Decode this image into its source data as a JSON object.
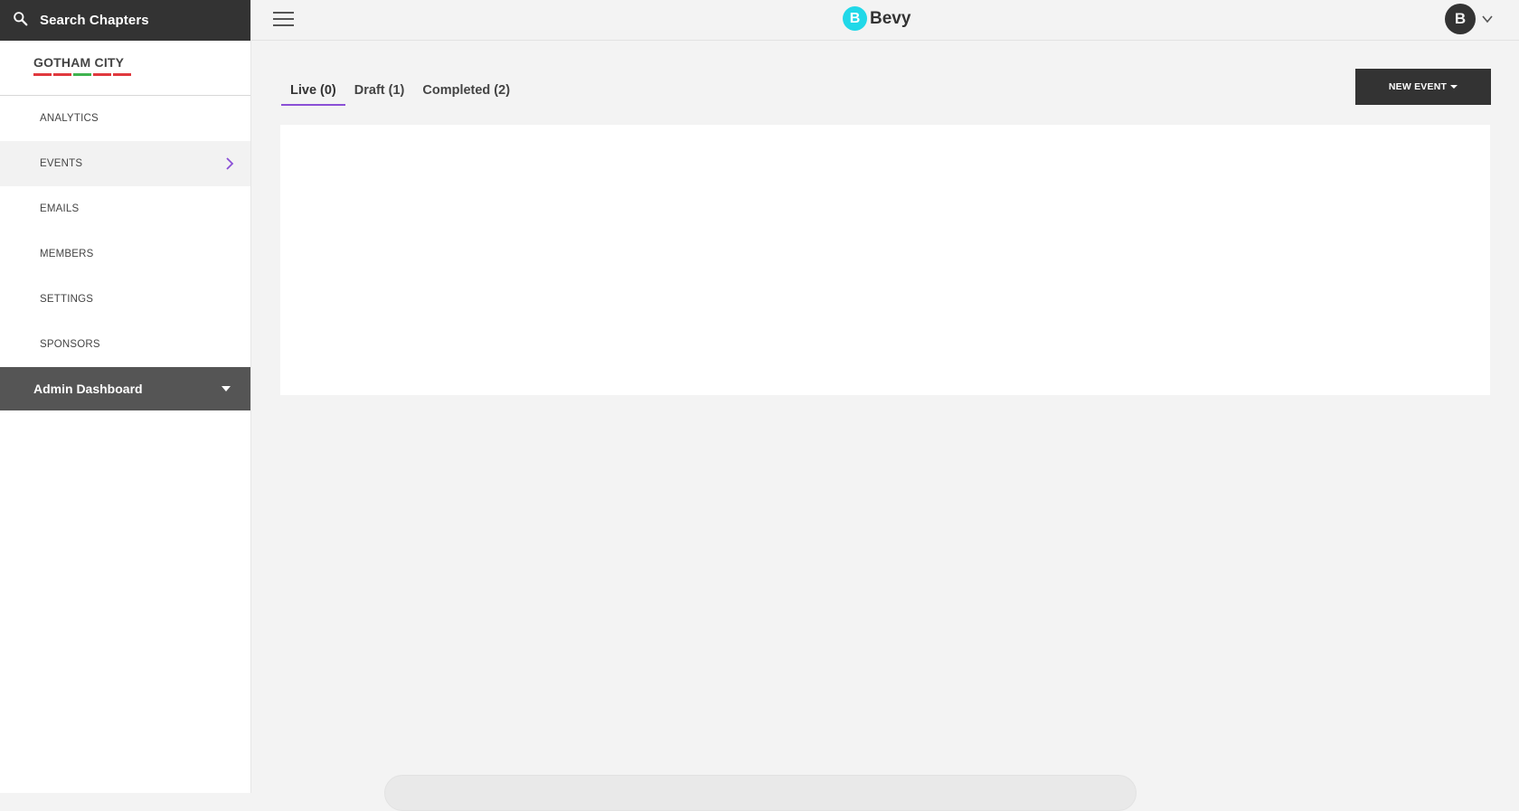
{
  "sidebar": {
    "search_label": "Search Chapters",
    "chapter": {
      "name": "GOTHAM CITY",
      "bar_colors": [
        "#e0393e",
        "#e0393e",
        "#3fb34f",
        "#e0393e",
        "#e0393e"
      ]
    },
    "items": [
      {
        "label": "ANALYTICS",
        "active": false
      },
      {
        "label": "EVENTS",
        "active": true
      },
      {
        "label": "EMAILS",
        "active": false
      },
      {
        "label": "MEMBERS",
        "active": false
      },
      {
        "label": "SETTINGS",
        "active": false
      },
      {
        "label": "SPONSORS",
        "active": false
      }
    ],
    "admin_label": "Admin Dashboard"
  },
  "header": {
    "brand_name": "Bevy",
    "brand_mark": "B",
    "brand_color": "#21d8e8",
    "avatar_letter": "B"
  },
  "tabs": [
    {
      "label": "Live (0)",
      "active": true
    },
    {
      "label": "Draft (1)",
      "active": false
    },
    {
      "label": "Completed (2)",
      "active": false
    }
  ],
  "new_event_label": "NEW EVENT",
  "accent_color": "#8a4fd6"
}
